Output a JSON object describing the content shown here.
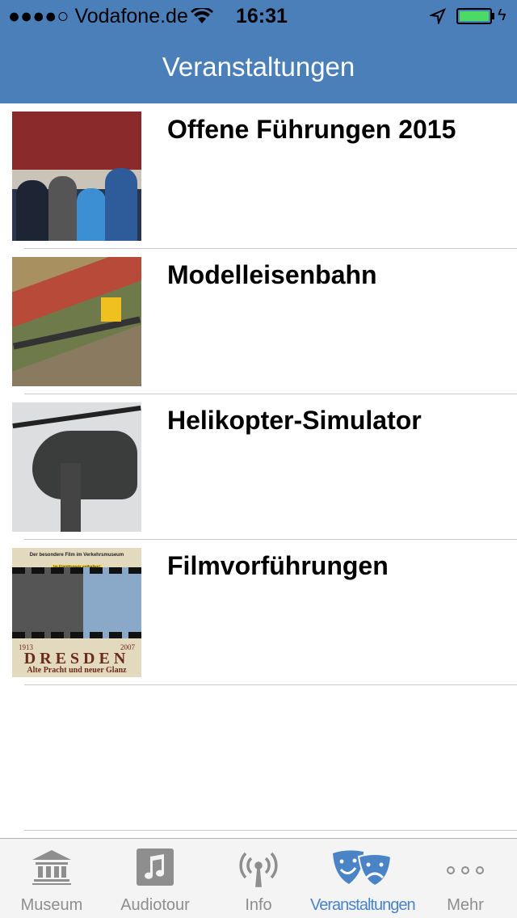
{
  "status_bar": {
    "carrier": "●●●●○ Vodafone.de",
    "time": "16:31",
    "battery_color": "#4cd964"
  },
  "nav": {
    "title": "Veranstaltungen",
    "bar_color": "#4a7fb9"
  },
  "events": [
    {
      "title": "Offene Führungen 2015",
      "thumbnail": "guided-tour-photo"
    },
    {
      "title": "Modelleisenbahn",
      "thumbnail": "model-railway-photo"
    },
    {
      "title": "Helikopter-Simulator",
      "thumbnail": "helicopter-photo"
    },
    {
      "title": "Filmvorführungen",
      "thumbnail": "film-poster",
      "poster": {
        "top": "Der besondere Film im Verkehrsmuseum",
        "badge": "Im Eintrittspreis enthalten!",
        "year_left": "1913",
        "year_right": "2007",
        "city": "DRESDEN",
        "subtitle": "Alte Pracht und neuer Glanz"
      }
    }
  ],
  "tabs": [
    {
      "label": "Museum",
      "icon": "museum-icon"
    },
    {
      "label": "Audiotour",
      "icon": "music-note-icon"
    },
    {
      "label": "Info",
      "icon": "antenna-icon"
    },
    {
      "label": "Veranstaltungen",
      "icon": "theater-masks-icon",
      "active": true
    },
    {
      "label": "Mehr",
      "icon": "more-dots-icon"
    }
  ],
  "accent": "#4a84c6"
}
